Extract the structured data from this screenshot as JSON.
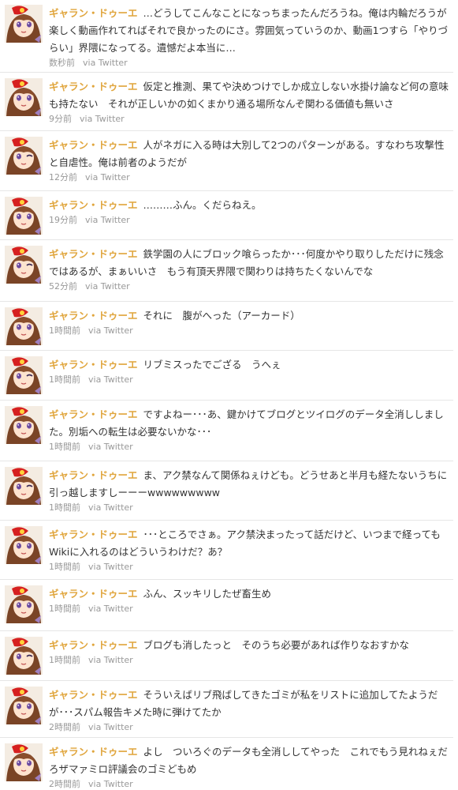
{
  "colors": {
    "username": "#e0a53c",
    "text": "#333333",
    "meta": "#999999",
    "divider": "#e6e6e6"
  },
  "tweets": [
    {
      "avatar_icon": "avatar-character-icon",
      "name": "ギャラン・ドゥーエ",
      "text": "…どうしてこんなことになっちまったんだろうね。俺は内輪だろうが楽しく動画作れてればそれで良かったのにさ。雰囲気っていうのか、動画1つすら「やりづらい」界隈になってる。遺憾だよ本当に…",
      "time": "数秒前",
      "source": "via Twitter"
    },
    {
      "avatar_icon": "avatar-character-icon",
      "name": "ギャラン・ドゥーエ",
      "text": "仮定と推測、果てや決めつけでしか成立しない水掛け論など何の意味も持たない　それが正しいかの如くまかり通る場所なんぞ関わる価値も無いさ",
      "time": "9分前",
      "source": "via Twitter"
    },
    {
      "avatar_icon": "avatar-character-wink-icon",
      "name": "ギャラン・ドゥーエ",
      "text": "人がネガに入る時は大別して2つのパターンがある。すなわち攻撃性と自虐性。俺は前者のようだが",
      "time": "12分前",
      "source": "via Twitter"
    },
    {
      "avatar_icon": "avatar-character-icon",
      "name": "ギャラン・ドゥーエ",
      "text": "………ふん。くだらねえ。",
      "time": "19分前",
      "source": "via Twitter"
    },
    {
      "avatar_icon": "avatar-character-wink-icon",
      "name": "ギャラン・ドゥーエ",
      "text": "鉄学園の人にブロック喰らったか･･･何度かやり取りしただけに残念ではあるが、まぁいいさ　もう有頂天界隈で関わりは持ちたくないんでな",
      "time": "52分前",
      "source": "via Twitter"
    },
    {
      "avatar_icon": "avatar-character-icon",
      "name": "ギャラン・ドゥーエ",
      "text": "それに　腹がへった（アーカード）",
      "time": "1時間前",
      "source": "via Twitter"
    },
    {
      "avatar_icon": "avatar-character-wink-icon",
      "name": "ギャラン・ドゥーエ",
      "text": "リブミスったでござる　うへぇ",
      "time": "1時間前",
      "source": "via Twitter"
    },
    {
      "avatar_icon": "avatar-character-icon",
      "name": "ギャラン・ドゥーエ",
      "text": "ですよねー･･･あ、鍵かけてブログとツイログのデータ全消ししました。別垢への転生は必要ないかな･･･",
      "time": "1時間前",
      "source": "via Twitter"
    },
    {
      "avatar_icon": "avatar-character-wink-icon",
      "name": "ギャラン・ドゥーエ",
      "text": "ま、アク禁なんて関係ねぇけども。どうせあと半月も経たないうちに引っ越しますしーーーwwwwwwwww",
      "time": "1時間前",
      "source": "via Twitter"
    },
    {
      "avatar_icon": "avatar-character-icon",
      "name": "ギャラン・ドゥーエ",
      "text": "･･･ところでさぁ。アク禁決まったって話だけど、いつまで経ってもWikiに入れるのはどういうわけだ？あ？",
      "time": "1時間前",
      "source": "via Twitter"
    },
    {
      "avatar_icon": "avatar-character-icon",
      "name": "ギャラン・ドゥーエ",
      "text": "ふん、スッキリしたぜ畜生め",
      "time": "1時間前",
      "source": "via Twitter"
    },
    {
      "avatar_icon": "avatar-character-wink-icon",
      "name": "ギャラン・ドゥーエ",
      "text": "ブログも消したっと　そのうち必要があれば作りなおすかな",
      "time": "1時間前",
      "source": "via Twitter"
    },
    {
      "avatar_icon": "avatar-character-icon",
      "name": "ギャラン・ドゥーエ",
      "text": "そういえばリブ飛ばしてきたゴミが私をリストに追加してたようだが･･･スパム報告キメた時に弾けてたか",
      "time": "2時間前",
      "source": "via Twitter"
    },
    {
      "avatar_icon": "avatar-character-icon",
      "name": "ギャラン・ドゥーエ",
      "text": "よし　ついろぐのデータも全消ししてやった　これでもう見れねぇだろザマァミロ評議会のゴミどもめ",
      "time": "2時間前",
      "source": "via Twitter"
    }
  ]
}
